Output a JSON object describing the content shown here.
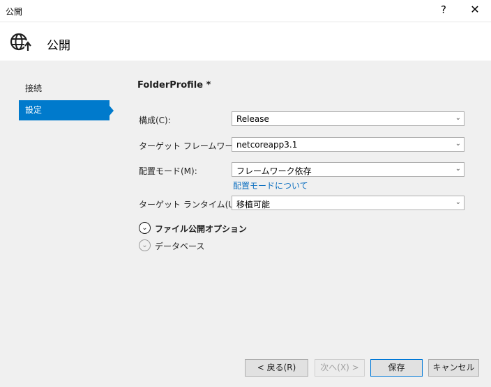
{
  "window": {
    "title": "公開",
    "help_label": "?",
    "close_label": "✕"
  },
  "header": {
    "icon": "globe-publish-icon",
    "heading": "公開"
  },
  "sidebar": {
    "items": [
      {
        "label": "接続",
        "active": false
      },
      {
        "label": "設定",
        "active": true
      }
    ]
  },
  "profile": {
    "name": "FolderProfile *"
  },
  "fields": [
    {
      "label": "構成(C):",
      "value": "Release"
    },
    {
      "label": "ターゲット フレームワーク(F):",
      "value": "netcoreapp3.1"
    },
    {
      "label": "配置モード(M):",
      "value": "フレームワーク依存"
    },
    {
      "label": "ターゲット ランタイム(U):",
      "value": "移植可能"
    }
  ],
  "deploy_mode_link": "配置モードについて",
  "sections": [
    {
      "label": "ファイル公開オプション",
      "expanded": false
    },
    {
      "label": "データベース",
      "expanded": false
    }
  ],
  "buttons": {
    "back": "< 戻る(R)",
    "next": "次へ(X) >",
    "save": "保存",
    "cancel": "キャンセル"
  },
  "colors": {
    "accent": "#007acc",
    "link": "#0e70c0"
  }
}
